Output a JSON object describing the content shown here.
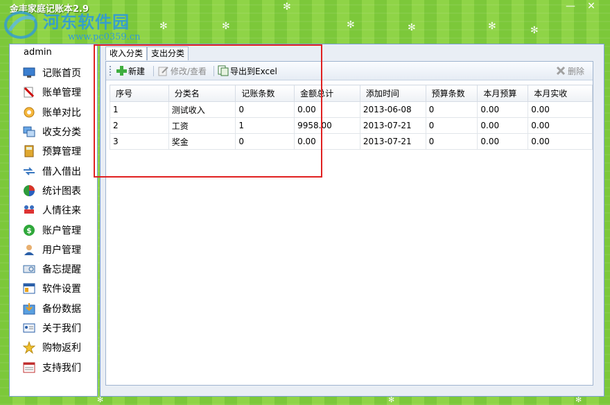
{
  "window": {
    "title": "金丰家庭记账本2.9",
    "watermark_text": "河东软件园",
    "watermark_url": "www.pc0359.cn",
    "minimize_label": "—",
    "close_label": "✕"
  },
  "sidebar": {
    "user": "admin",
    "items": [
      {
        "label": "记账首页",
        "icon": "monitor-icon"
      },
      {
        "label": "账单管理",
        "icon": "pen-icon"
      },
      {
        "label": "账单对比",
        "icon": "gear-sun-icon"
      },
      {
        "label": "收支分类",
        "icon": "windows-icon"
      },
      {
        "label": "预算管理",
        "icon": "calculator-icon"
      },
      {
        "label": "借入借出",
        "icon": "transfer-icon"
      },
      {
        "label": "统计图表",
        "icon": "pie-chart-icon"
      },
      {
        "label": "人情往来",
        "icon": "handshake-icon"
      },
      {
        "label": "账户管理",
        "icon": "dollar-icon"
      },
      {
        "label": "用户管理",
        "icon": "user-icon"
      },
      {
        "label": "备忘提醒",
        "icon": "keyboard-icon"
      },
      {
        "label": "软件设置",
        "icon": "settings-window-icon"
      },
      {
        "label": "备份数据",
        "icon": "backup-icon"
      },
      {
        "label": "关于我们",
        "icon": "id-card-icon"
      },
      {
        "label": "购物返利",
        "icon": "star-icon"
      },
      {
        "label": "支持我们",
        "icon": "form-icon"
      }
    ]
  },
  "tabs": [
    {
      "label": "收入分类",
      "active": true
    },
    {
      "label": "支出分类",
      "active": false
    }
  ],
  "toolbar": {
    "new_label": "新建",
    "edit_label": "修改/查看",
    "export_label": "导出到Excel",
    "delete_label": "删除"
  },
  "table": {
    "columns": [
      "序号",
      "分类名",
      "记账条数",
      "金额总计",
      "添加时间",
      "预算条数",
      "本月预算",
      "本月实收"
    ],
    "rows": [
      [
        "1",
        "测试收入",
        "0",
        "0.00",
        "2013-06-08",
        "0",
        "0.00",
        "0.00"
      ],
      [
        "2",
        "工资",
        "1",
        "9958.00",
        "2013-07-21",
        "0",
        "0.00",
        "0.00"
      ],
      [
        "3",
        "奖金",
        "0",
        "0.00",
        "2013-07-21",
        "0",
        "0.00",
        "0.00"
      ]
    ]
  },
  "colors": {
    "background_green": "#8fd447",
    "highlight_box": "#e02020",
    "border_blue": "#7aa0d6"
  }
}
